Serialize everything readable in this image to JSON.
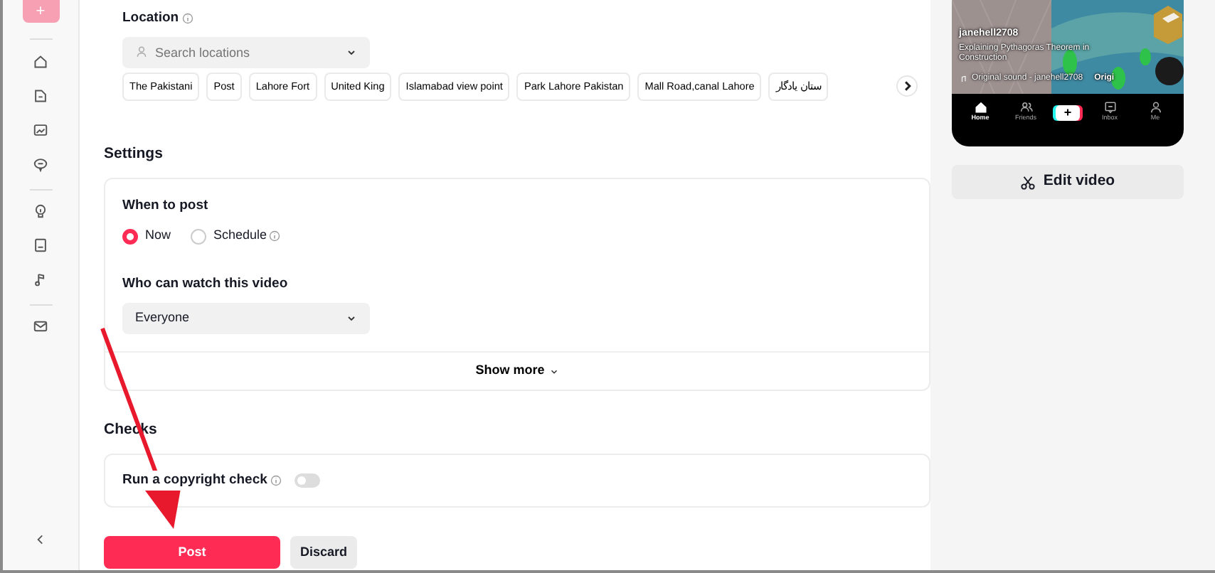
{
  "sidebar": {
    "create_button": "+"
  },
  "location": {
    "label": "Location",
    "placeholder": "Search locations",
    "chips": [
      "The Pakistani",
      "Post",
      "Lahore Fort",
      "United King",
      "Islamabad view point",
      "Park Lahore Pakistan",
      "Mall Road,canal Lahore",
      "ستان یادگار"
    ]
  },
  "settings": {
    "heading": "Settings",
    "when_to_post": {
      "label": "When to post",
      "options": [
        {
          "label": "Now",
          "selected": true,
          "info": false
        },
        {
          "label": "Schedule",
          "selected": false,
          "info": true
        }
      ]
    },
    "who_can_watch": {
      "label": "Who can watch this video",
      "value": "Everyone"
    },
    "show_more": "Show more"
  },
  "checks": {
    "heading": "Checks",
    "copyright": {
      "label": "Run a copyright check",
      "on": false
    }
  },
  "actions": {
    "post": "Post",
    "discard": "Discard"
  },
  "preview": {
    "username": "janehell2708",
    "caption": "Explaining Pythagoras Theorem in Construction",
    "sound": "Original sound - janehell2708",
    "sound_tag": "Origi",
    "nav": [
      {
        "kind": "home",
        "label": "Home",
        "selected": true
      },
      {
        "kind": "friends",
        "label": "Friends",
        "selected": false
      },
      {
        "kind": "create",
        "label": "+",
        "selected": false
      },
      {
        "kind": "inbox",
        "label": "Inbox",
        "selected": false
      },
      {
        "kind": "me",
        "label": "Me",
        "selected": false
      }
    ],
    "edit_button": "Edit video"
  }
}
